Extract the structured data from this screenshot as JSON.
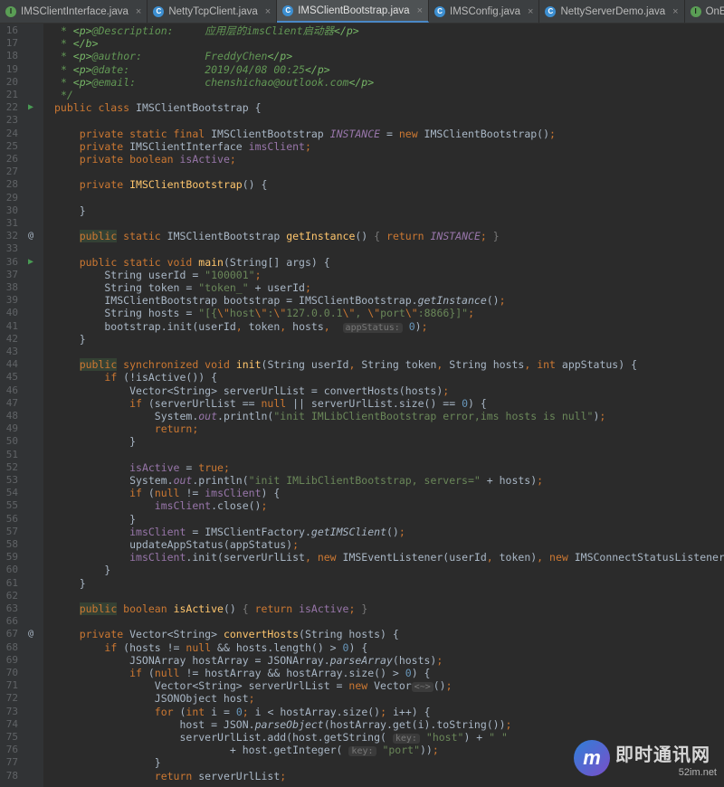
{
  "tabs": [
    {
      "icon": "I",
      "kind": "interface",
      "label": "IMSClientInterface.java",
      "active": false
    },
    {
      "icon": "C",
      "kind": "klass",
      "label": "NettyTcpClient.java",
      "active": false
    },
    {
      "icon": "C",
      "kind": "klass",
      "label": "IMSClientBootstrap.java",
      "active": true
    },
    {
      "icon": "C",
      "kind": "klass",
      "label": "IMSConfig.java",
      "active": false
    },
    {
      "icon": "C",
      "kind": "klass",
      "label": "NettyServerDemo.java",
      "active": false
    },
    {
      "icon": "I",
      "kind": "interface",
      "label": "OnEv",
      "active": false
    }
  ],
  "close_glyph": "×",
  "markers": {
    "run": "▶",
    "override": "@"
  },
  "lines": [
    {
      "n": 16,
      "m": "",
      "h": " <span class=\"c\">* </span><span class=\"ct\">&lt;p&gt;</span><span class=\"ca\">@Description:     </span><span class=\"c\">应用层的</span><span class=\"c\">imsClient</span><span class=\"c\">启动器</span><span class=\"ct\">&lt;/p&gt;</span>"
    },
    {
      "n": 17,
      "m": "",
      "h": " <span class=\"c\">* </span><span class=\"ct\">&lt;/b&gt;</span>"
    },
    {
      "n": 18,
      "m": "",
      "h": " <span class=\"c\">* </span><span class=\"ct\">&lt;p&gt;</span><span class=\"ca\">@author:          </span><span class=\"c\">FreddyChen</span><span class=\"ct\">&lt;/p&gt;</span>"
    },
    {
      "n": 19,
      "m": "",
      "h": " <span class=\"c\">* </span><span class=\"ct\">&lt;p&gt;</span><span class=\"ca\">@date:            </span><span class=\"c\">2019/04/08 00:25</span><span class=\"ct\">&lt;/p&gt;</span>"
    },
    {
      "n": 20,
      "m": "",
      "h": " <span class=\"c\">* </span><span class=\"ct\">&lt;p&gt;</span><span class=\"ca\">@email:           </span><span class=\"c\">chenshichao@outlook.com</span><span class=\"ct\">&lt;/p&gt;</span>"
    },
    {
      "n": 21,
      "m": "",
      "h": " <span class=\"c\">*/</span>"
    },
    {
      "n": 22,
      "m": "run",
      "h": "<span class=\"k\">public class </span>IMSClientBootstrap {"
    },
    {
      "n": 23,
      "m": "",
      "h": ""
    },
    {
      "n": 24,
      "m": "",
      "h": "    <span class=\"k\">private static final </span>IMSClientBootstrap <span class=\"fi\">INSTANCE </span>= <span class=\"k\">new </span>IMSClientBootstrap()<span class=\"k\">;</span>"
    },
    {
      "n": 25,
      "m": "",
      "h": "    <span class=\"k\">private </span>IMSClientInterface <span class=\"f\">imsClient</span><span class=\"k\">;</span>"
    },
    {
      "n": 26,
      "m": "",
      "h": "    <span class=\"k\">private boolean </span><span class=\"f\">isActive</span><span class=\"k\">;</span>"
    },
    {
      "n": 27,
      "m": "",
      "h": ""
    },
    {
      "n": 28,
      "m": "",
      "h": "    <span class=\"k\">private </span><span class=\"m\">IMSClientBootstrap</span>() {"
    },
    {
      "n": 29,
      "m": "",
      "h": ""
    },
    {
      "n": 30,
      "m": "",
      "h": "    }"
    },
    {
      "n": 31,
      "m": "",
      "h": ""
    },
    {
      "n": 32,
      "m": "override",
      "h": "    <span class=\"k hl\">public</span><span class=\"k\"> static </span>IMSClientBootstrap <span class=\"m\">getInstance</span>() <span class=\"fold\">{ </span><span class=\"k\">return </span><span class=\"fi\">INSTANCE</span><span class=\"k\">; </span><span class=\"fold\">}</span>"
    },
    {
      "n": 33,
      "m": "",
      "h": ""
    },
    {
      "n": 36,
      "m": "run",
      "h": "    <span class=\"k\">public static void </span><span class=\"m\">main</span>(String[] args) {"
    },
    {
      "n": 37,
      "m": "",
      "h": "        String userId = <span class=\"s\">\"100001\"</span><span class=\"k\">;</span>"
    },
    {
      "n": 38,
      "m": "",
      "h": "        String token = <span class=\"s\">\"token_\" </span>+ userId<span class=\"k\">;</span>"
    },
    {
      "n": 39,
      "m": "",
      "h": "        IMSClientBootstrap bootstrap = IMSClientBootstrap.<span class=\"it\">getInstance</span>()<span class=\"k\">;</span>"
    },
    {
      "n": 40,
      "m": "",
      "h": "        String hosts = <span class=\"s\">\"[{</span><span class=\"k\">\\\"</span><span class=\"s\">host</span><span class=\"k\">\\\"</span><span class=\"s\">:</span><span class=\"k\">\\\"</span><span class=\"s\">127.0.0.1</span><span class=\"k\">\\\"</span><span class=\"s\">, </span><span class=\"k\">\\\"</span><span class=\"s\">port</span><span class=\"k\">\\\"</span><span class=\"s\">:8866}]\"</span><span class=\"k\">;</span>"
    },
    {
      "n": 41,
      "m": "",
      "h": "        bootstrap.init(userId<span class=\"k\">, </span>token<span class=\"k\">, </span>hosts<span class=\"k\">,  </span><span class=\"hint\">appStatus:</span> <span class=\"n\">0</span>)<span class=\"k\">;</span>"
    },
    {
      "n": 42,
      "m": "",
      "h": "    }"
    },
    {
      "n": 43,
      "m": "",
      "h": ""
    },
    {
      "n": 44,
      "m": "",
      "h": "    <span class=\"k hl\">public</span><span class=\"k\"> synchronized void </span><span class=\"m\">init</span>(String userId<span class=\"k\">, </span>String token<span class=\"k\">, </span>String hosts<span class=\"k\">, int </span>appStatus) {"
    },
    {
      "n": 45,
      "m": "",
      "h": "        <span class=\"k\">if </span>(!isActive()) {"
    },
    {
      "n": 46,
      "m": "",
      "h": "            Vector&lt;String&gt; serverUrlList = convertHosts(hosts)<span class=\"k\">;</span>"
    },
    {
      "n": 47,
      "m": "",
      "h": "            <span class=\"k\">if </span>(serverUrlList == <span class=\"k\">null </span>|| serverUrlList.size() == <span class=\"n\">0</span>) {"
    },
    {
      "n": 48,
      "m": "",
      "h": "                System.<span class=\"fi\">out</span>.println(<span class=\"s\">\"init IMLibClientBootstrap error,ims hosts is null\"</span>)<span class=\"k\">;</span>"
    },
    {
      "n": 49,
      "m": "",
      "h": "                <span class=\"k\">return;</span>"
    },
    {
      "n": 50,
      "m": "",
      "h": "            }"
    },
    {
      "n": 51,
      "m": "",
      "h": ""
    },
    {
      "n": 52,
      "m": "",
      "h": "            <span class=\"f\">isActive </span>= <span class=\"k\">true;</span>"
    },
    {
      "n": 53,
      "m": "",
      "h": "            System.<span class=\"fi\">out</span>.println(<span class=\"s\">\"init IMLibClientBootstrap, servers=\" </span>+ hosts)<span class=\"k\">;</span>"
    },
    {
      "n": 54,
      "m": "",
      "h": "            <span class=\"k\">if </span>(<span class=\"k\">null </span>!= <span class=\"f\">imsClient</span>) {"
    },
    {
      "n": 55,
      "m": "",
      "h": "                <span class=\"f\">imsClient</span>.close()<span class=\"k\">;</span>"
    },
    {
      "n": 56,
      "m": "",
      "h": "            }"
    },
    {
      "n": 57,
      "m": "",
      "h": "            <span class=\"f\">imsClient </span>= IMSClientFactory.<span class=\"it\">getIMSClient</span>()<span class=\"k\">;</span>"
    },
    {
      "n": 58,
      "m": "",
      "h": "            updateAppStatus(appStatus)<span class=\"k\">;</span>"
    },
    {
      "n": 59,
      "m": "",
      "h": "            <span class=\"f\">imsClient</span>.init(serverUrlList<span class=\"k\">, new </span>IMSEventListener(userId<span class=\"k\">, </span>token)<span class=\"k\">, new </span>IMSConnectStatusListener())<span class=\"k\">;</span>"
    },
    {
      "n": 60,
      "m": "",
      "h": "        }"
    },
    {
      "n": 61,
      "m": "",
      "h": "    }"
    },
    {
      "n": 62,
      "m": "",
      "h": ""
    },
    {
      "n": 63,
      "m": "",
      "h": "    <span class=\"k hl\">public</span><span class=\"k\"> boolean </span><span class=\"m\">isActive</span>() <span class=\"fold\">{ </span><span class=\"k\">return </span><span class=\"f\">isActive</span><span class=\"k\">; </span><span class=\"fold\">}</span>"
    },
    {
      "n": 66,
      "m": "",
      "h": ""
    },
    {
      "n": 67,
      "m": "override",
      "h": "    <span class=\"k\">private </span>Vector&lt;String&gt; <span class=\"m\">convertHosts</span>(String hosts) {"
    },
    {
      "n": 68,
      "m": "",
      "h": "        <span class=\"k\">if </span>(hosts != <span class=\"k\">null </span>&amp;&amp; hosts.length() &gt; <span class=\"n\">0</span>) {"
    },
    {
      "n": 69,
      "m": "",
      "h": "            JSONArray hostArray = JSONArray.<span class=\"it\">parseArray</span>(hosts)<span class=\"k\">;</span>"
    },
    {
      "n": 70,
      "m": "",
      "h": "            <span class=\"k\">if </span>(<span class=\"k\">null </span>!= hostArray &amp;&amp; hostArray.size() &gt; <span class=\"n\">0</span>) {"
    },
    {
      "n": 71,
      "m": "",
      "h": "                Vector&lt;String&gt; serverUrlList = <span class=\"k\">new </span>Vector<span class=\"hint\">&lt;~&gt;</span>()<span class=\"k\">;</span>"
    },
    {
      "n": 72,
      "m": "",
      "h": "                JSONObject host<span class=\"k\">;</span>"
    },
    {
      "n": 73,
      "m": "",
      "h": "                <span class=\"k\">for </span>(<span class=\"k\">int </span>i = <span class=\"n\">0</span><span class=\"k\">; </span>i &lt; hostArray.size()<span class=\"k\">; </span>i++) {"
    },
    {
      "n": 74,
      "m": "",
      "h": "                    host = JSON.<span class=\"it\">parseObject</span>(hostArray.get(i).toString())<span class=\"k\">;</span>"
    },
    {
      "n": 75,
      "m": "",
      "h": "                    serverUrlList.add(host.getString( <span class=\"hint\">key:</span> <span class=\"s\">\"host\"</span>) + <span class=\"s\">\" \"</span>"
    },
    {
      "n": 76,
      "m": "",
      "h": "                            + host.getInteger( <span class=\"hint\">key:</span> <span class=\"s\">\"port\"</span>))<span class=\"k\">;</span>"
    },
    {
      "n": 77,
      "m": "",
      "h": "                }"
    },
    {
      "n": 78,
      "m": "",
      "h": "                <span class=\"k\">return </span>serverUrlList<span class=\"k\">;</span>"
    }
  ],
  "watermark": {
    "logo_letter": "m",
    "title": "即时通讯网",
    "url": "52im.net"
  }
}
